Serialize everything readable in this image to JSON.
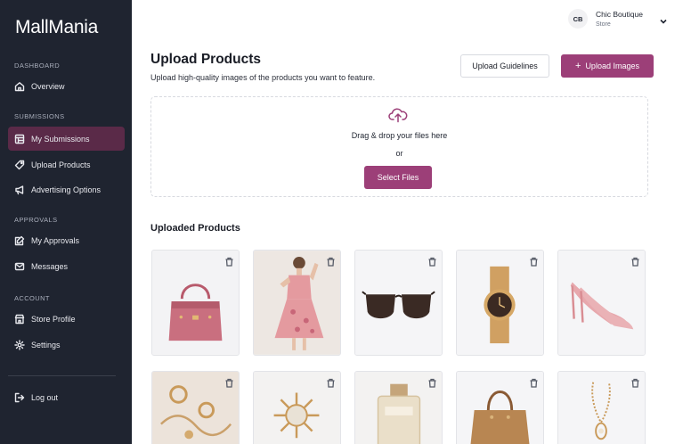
{
  "sidebar": {
    "logo": "MallMania",
    "sections": {
      "dashboard": "DASHBOARD",
      "submissions": "SUBMISSIONS",
      "approvals": "APPROVALS",
      "account": "ACCOUNT"
    },
    "items": {
      "overview": "Overview",
      "my_submissions": "My Submissions",
      "upload_products": "Upload Products",
      "advertising_options": "Advertising Options",
      "my_approvals": "My Approvals",
      "messages": "Messages",
      "store_profile": "Store Profile",
      "settings": "Settings",
      "logout": "Log out"
    },
    "active_item": "my_submissions"
  },
  "user": {
    "initials": "CB",
    "name": "Chic Boutique",
    "role": "Store"
  },
  "header": {
    "title": "Upload Products",
    "subtitle": "Upload high-quality images of the products you want to feature.",
    "guidelines_label": "Upload Guidelines",
    "upload_images_label": "Upload Images"
  },
  "dropzone": {
    "text": "Drag & drop your files here",
    "or": "or",
    "select_label": "Select Files"
  },
  "uploaded": {
    "heading": "Uploaded Products",
    "products": [
      {
        "icon": "pink-handbag"
      },
      {
        "icon": "floral-dress"
      },
      {
        "icon": "sunglasses"
      },
      {
        "icon": "gold-watch"
      },
      {
        "icon": "pink-heels"
      },
      {
        "icon": "gold-jewelry"
      },
      {
        "icon": "gold-brooch"
      },
      {
        "icon": "perfume-bottle"
      },
      {
        "icon": "brown-handbag"
      },
      {
        "icon": "pendant-necklace"
      }
    ]
  },
  "colors": {
    "sidebar_bg": "#1f2430",
    "active_bg": "#5a2a48",
    "accent": "#9c3f78"
  }
}
